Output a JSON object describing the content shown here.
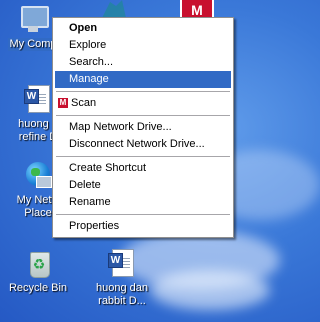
{
  "desktop": {
    "icons": [
      {
        "label": "My Comp",
        "selected": true
      },
      {
        "label": "huong d\nrefine D"
      },
      {
        "label": "My Netw\nPlace"
      },
      {
        "label": "Recycle Bin"
      },
      {
        "label": "huong dan\nrabbit D..."
      }
    ]
  },
  "context_menu": {
    "items": [
      {
        "label": "Open",
        "default": true
      },
      {
        "label": "Explore"
      },
      {
        "label": "Search..."
      },
      {
        "label": "Manage",
        "highlighted": true
      },
      {
        "label": "Scan",
        "icon": "mcafee-icon"
      },
      {
        "label": "Map Network Drive..."
      },
      {
        "label": "Disconnect Network Drive..."
      },
      {
        "label": "Create Shortcut"
      },
      {
        "label": "Delete"
      },
      {
        "label": "Rename"
      },
      {
        "label": "Properties"
      }
    ]
  },
  "colors": {
    "selection": "#316ac5",
    "desktop": "#3a78d8",
    "mcafee": "#c8102e"
  }
}
